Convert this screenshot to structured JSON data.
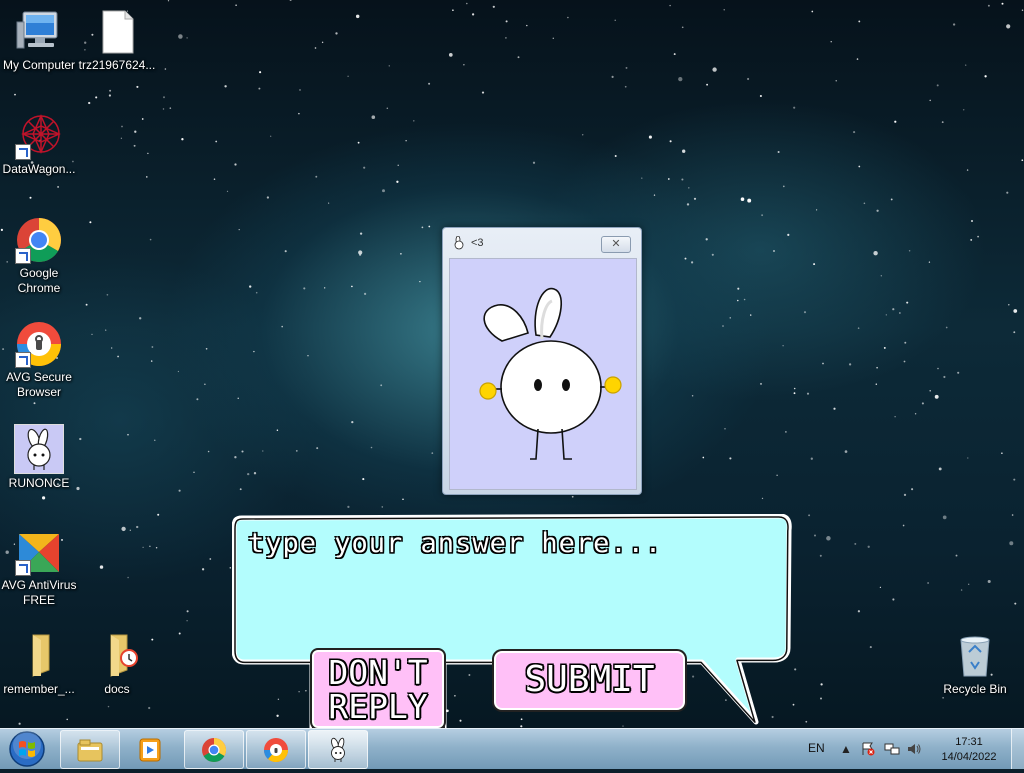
{
  "desktop": {
    "icons": [
      {
        "label": "My Computer"
      },
      {
        "label": "trz21967624..."
      },
      {
        "label": "DataWagon..."
      },
      {
        "label": "Google Chrome"
      },
      {
        "label": "AVG Secure Browser"
      },
      {
        "label": "RUNONCE"
      },
      {
        "label": "AVG AntiVirus FREE"
      },
      {
        "label": "remember_..."
      },
      {
        "label": "docs"
      },
      {
        "label": "Recycle Bin"
      }
    ]
  },
  "popup_window": {
    "title": "<3",
    "close_glyph": "✕"
  },
  "answer_box": {
    "placeholder": "type your answer here...",
    "bubble_color": "#b3fdfd"
  },
  "buttons": {
    "dont_reply_line1": "DON'T",
    "dont_reply_line2": "REPLY",
    "submit": "SUBMIT",
    "button_color": "#ffc0f7"
  },
  "taskbar": {
    "pinned": [
      "windows-explorer-icon",
      "media-player-icon",
      "chrome-icon",
      "avg-browser-icon",
      "bunny-app-icon"
    ],
    "language": "EN",
    "time": "17:31",
    "date": "14/04/2022"
  }
}
